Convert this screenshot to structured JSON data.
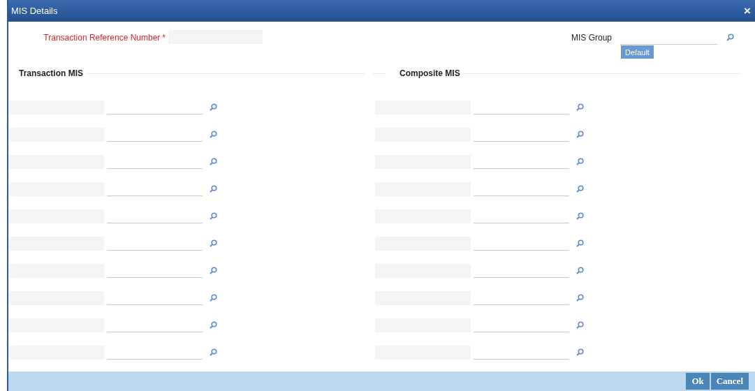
{
  "window": {
    "title": "MIS Details",
    "close": "×"
  },
  "reference": {
    "label": "Transaction Reference Number",
    "required_mark": "*"
  },
  "mis_group": {
    "label": "MIS Group",
    "button": "Default"
  },
  "sections": [
    {
      "title": "Transaction MIS",
      "rows": [
        {
          "kind": "lookup"
        },
        {
          "kind": "lookup"
        },
        {
          "kind": "lookup"
        },
        {
          "kind": "lookup"
        },
        {
          "kind": "lookup"
        },
        {
          "kind": "lookup"
        },
        {
          "kind": "lookup"
        },
        {
          "kind": "lookup"
        },
        {
          "kind": "lookup"
        },
        {
          "kind": "lookup"
        }
      ]
    },
    {
      "title": "Composite MIS",
      "rows": [
        {
          "kind": "lookup"
        },
        {
          "kind": "lookup"
        },
        {
          "kind": "lookup"
        },
        {
          "kind": "lookup"
        },
        {
          "kind": "lookup"
        },
        {
          "kind": "lookup"
        },
        {
          "kind": "lookup"
        },
        {
          "kind": "lookup"
        },
        {
          "kind": "lookup"
        },
        {
          "kind": "lookup"
        }
      ]
    }
  ],
  "buttons": [
    "Ok",
    "Cancel"
  ]
}
